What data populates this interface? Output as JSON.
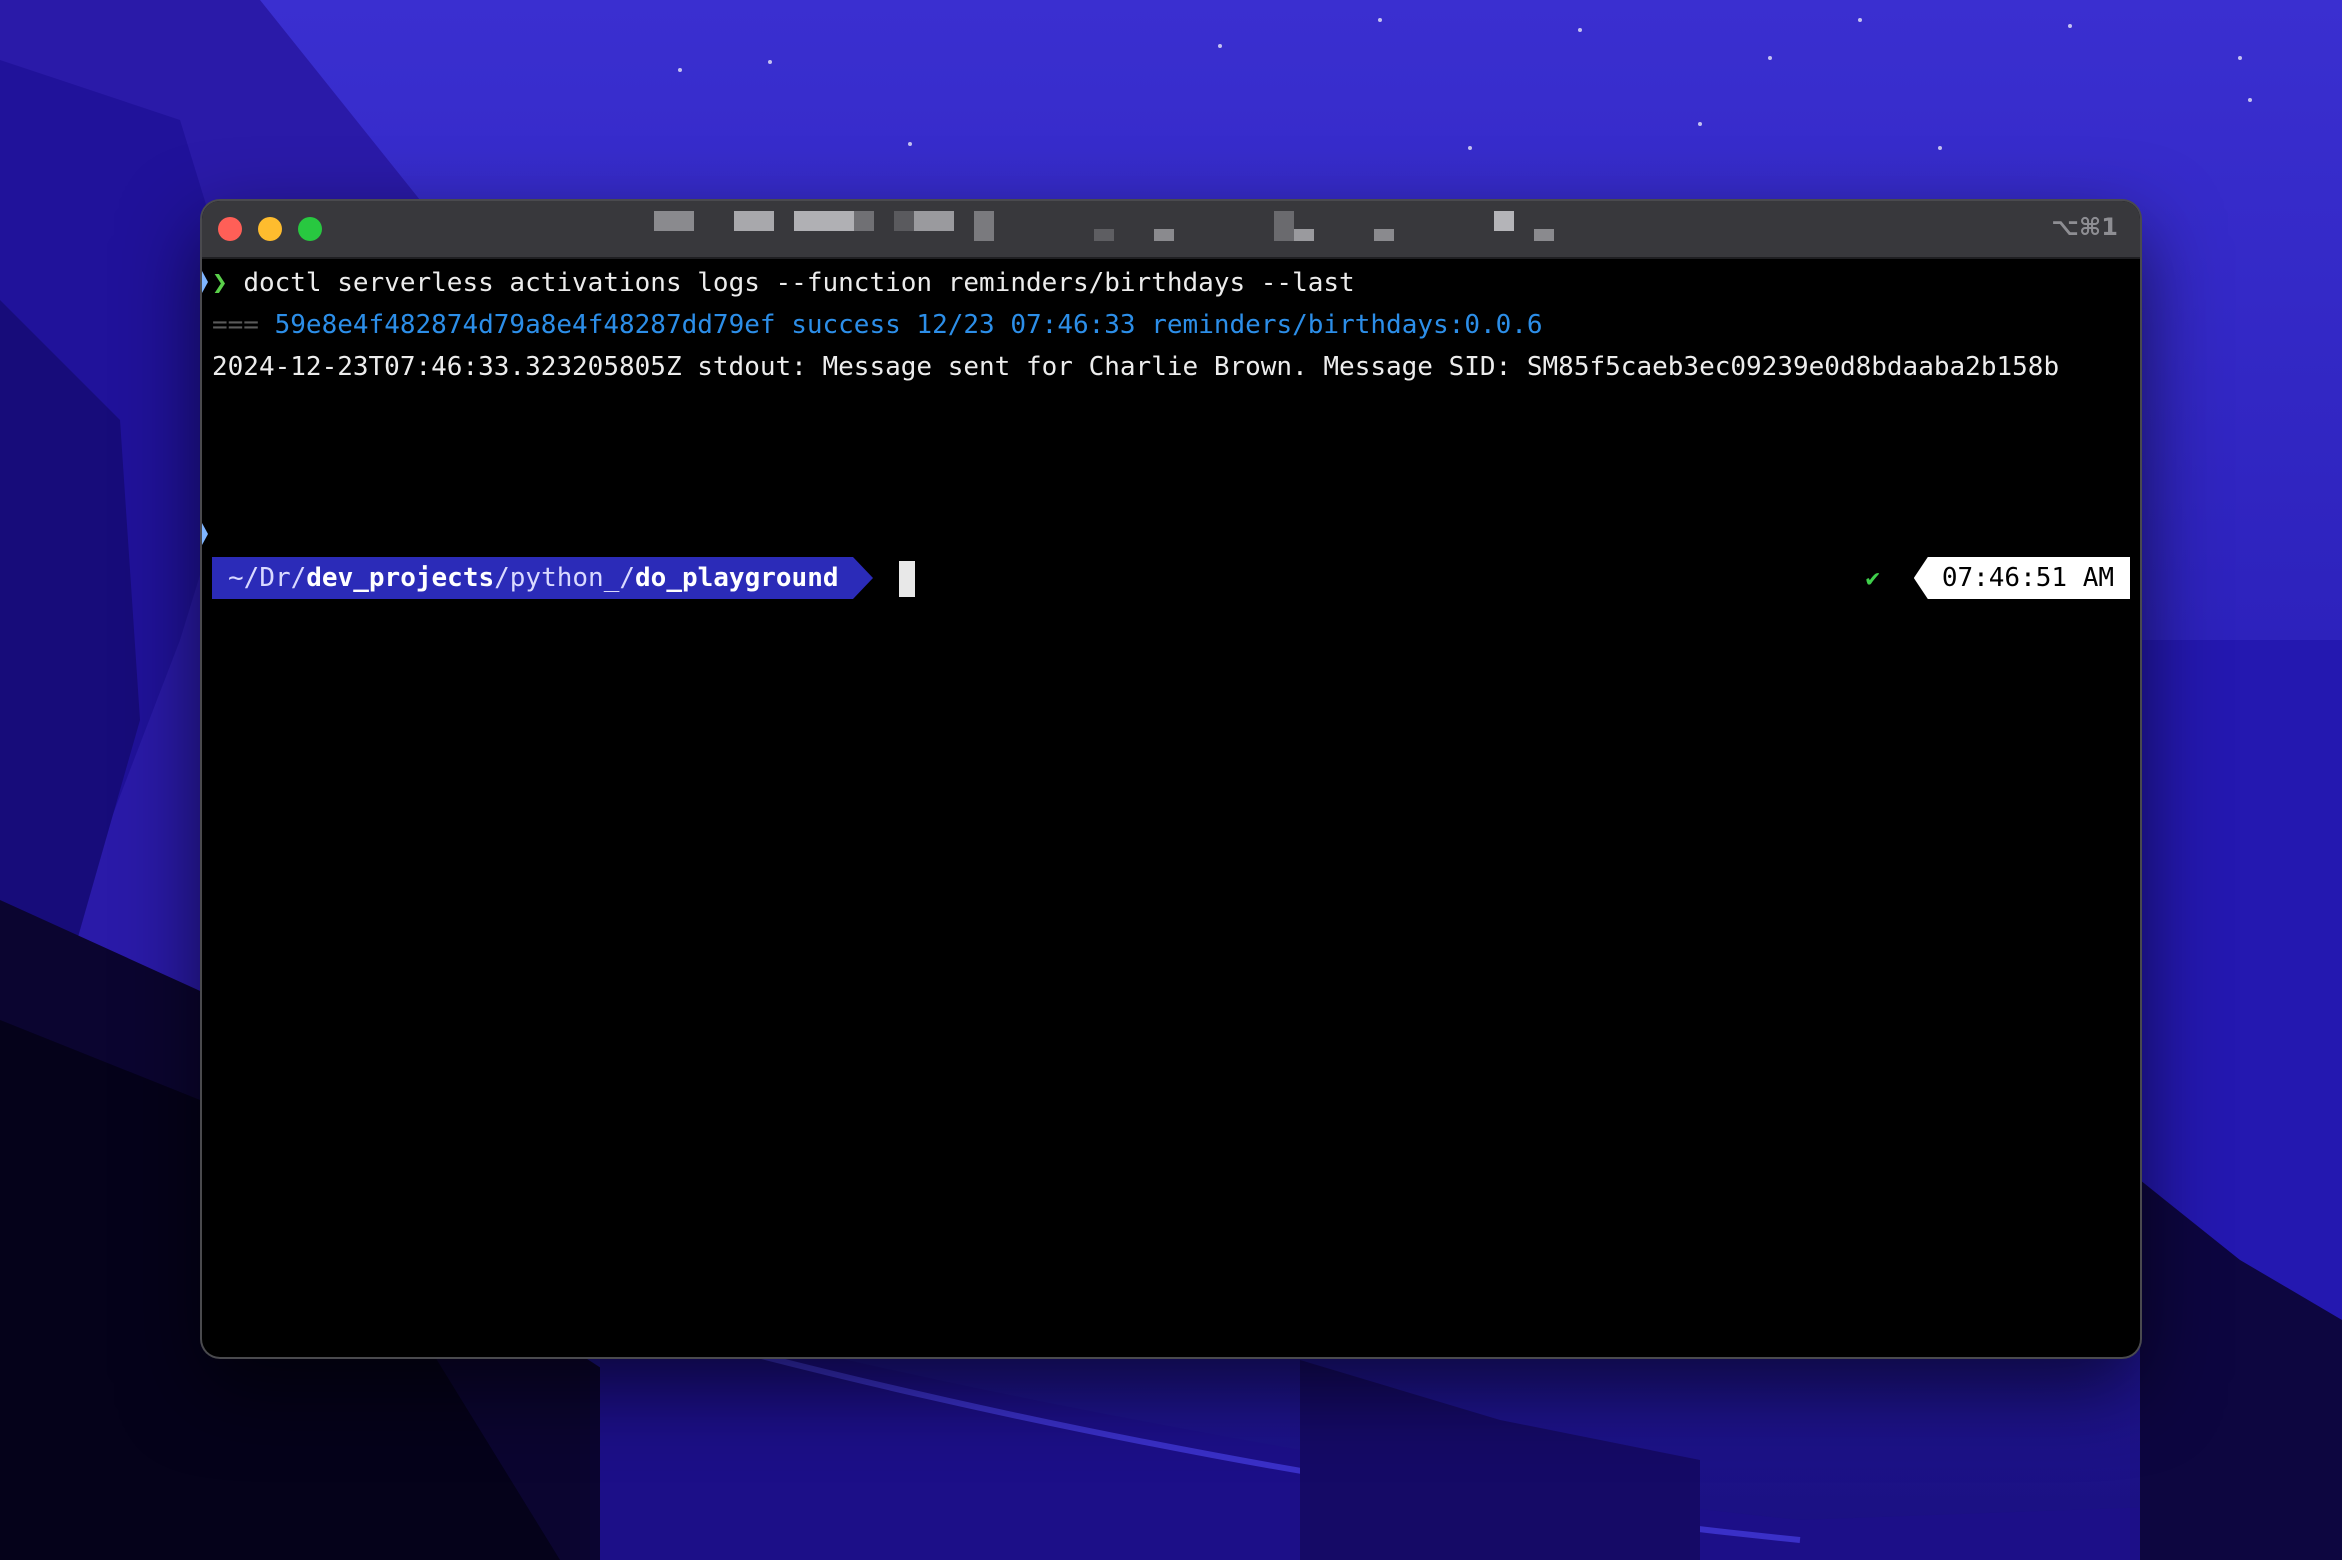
{
  "window": {
    "shortcut": "⌥⌘1"
  },
  "terminal": {
    "command_prompt": "❯",
    "command": "doctl serverless activations logs --function reminders/birthdays --last",
    "activation": {
      "separator": "===",
      "id": "59e8e4f482874d79a8e4f48287dd79ef",
      "status": "success",
      "date": "12/23",
      "time": "07:46:33",
      "function_version": "reminders/birthdays:0.0.6"
    },
    "log_line": "2024-12-23T07:46:33.323205805Z stdout: Message sent for Charlie Brown. Message SID: SM85f5caeb3ec09239e0d8bdaaba2b158b",
    "prompt_path": {
      "home": "~/",
      "dir1": "Dr",
      "sep1": "/",
      "dir2": "dev_projects",
      "sep2": "/",
      "dir3": "python_",
      "sep3": "/",
      "dir4": "do_playground"
    },
    "status_check": "✔",
    "clock": "07:46:51 AM"
  },
  "colors": {
    "path_bg": "#2b2bb8",
    "meta_blue": "#2c8ee8",
    "check_green": "#3fcf4b",
    "prompt_green": "#5ad04a"
  },
  "icons": [
    "close-icon",
    "minimize-icon",
    "maximize-icon",
    "check-icon",
    "cursor-icon"
  ]
}
